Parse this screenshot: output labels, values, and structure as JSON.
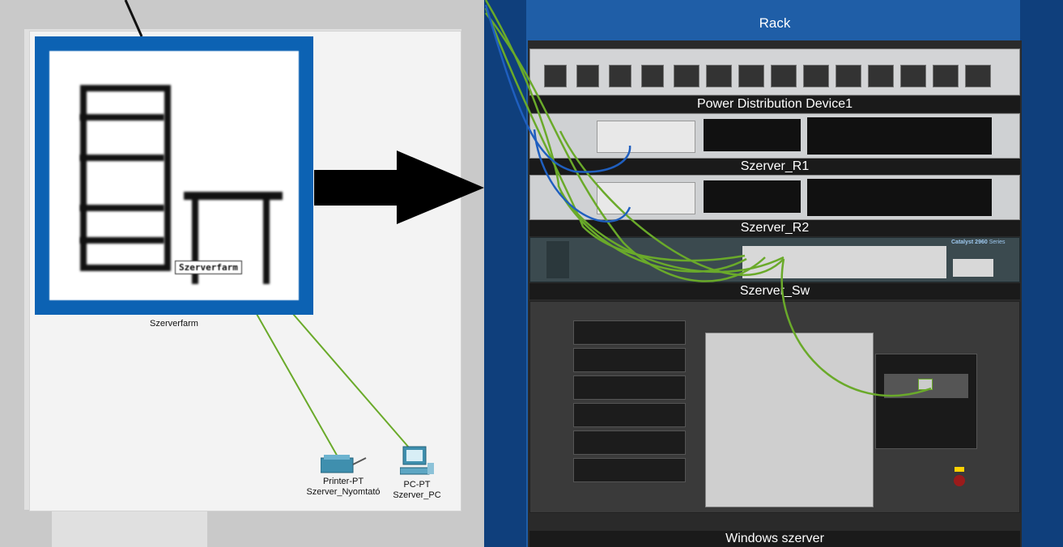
{
  "workspace": {
    "cluster_label": "Szerverfarm",
    "tooltip": "Szerverfarm",
    "devices": [
      {
        "type": "Printer-PT",
        "name": "Szerver_Nyomtató"
      },
      {
        "type": "PC-PT",
        "name": "Szerver_PC"
      }
    ]
  },
  "rack": {
    "title": "Rack",
    "devices": [
      "Power Distribution Device1",
      "Szerver_R1",
      "Szerver_R2",
      "Szerver_Sw",
      "Windows szerver"
    ],
    "switch_model": "Catalyst 2960",
    "switch_series": "Series"
  },
  "colors": {
    "rack_blue": "#1f5ea7",
    "link_green": "#6aaa2a",
    "link_blue": "#1f5fbf",
    "icon_blue": "#0c62b3"
  }
}
